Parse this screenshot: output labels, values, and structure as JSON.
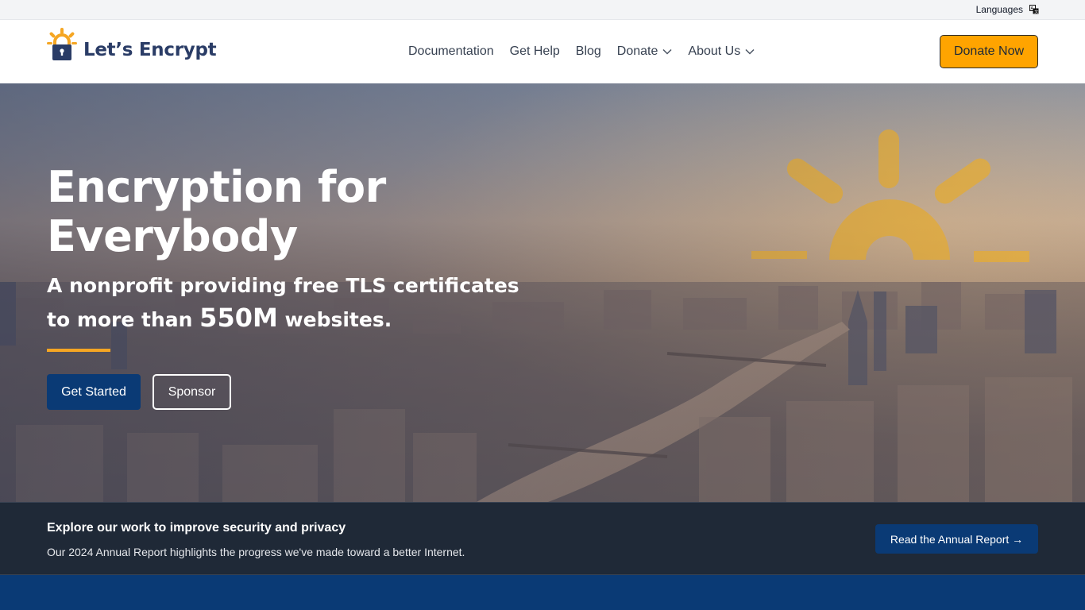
{
  "langbar": {
    "label": "Languages",
    "icon": "translate-icon"
  },
  "header": {
    "logo_text": "Let’s Encrypt",
    "nav": [
      {
        "label": "Documentation",
        "has_dropdown": false
      },
      {
        "label": "Get Help",
        "has_dropdown": false
      },
      {
        "label": "Blog",
        "has_dropdown": false
      },
      {
        "label": "Donate",
        "has_dropdown": true
      },
      {
        "label": "About Us",
        "has_dropdown": true
      }
    ],
    "donate_button": "Donate Now"
  },
  "hero": {
    "title": "Encryption for Everybody",
    "subtitle_part1": "A nonprofit providing free TLS certificates to more than ",
    "subtitle_big": "550M",
    "subtitle_part2": " websites.",
    "primary_button": "Get Started",
    "secondary_button": "Sponsor"
  },
  "report": {
    "title": "Explore our work to improve security and privacy",
    "description": "Our 2024 Annual Report highlights the progress we've made toward a better Internet.",
    "button": "Read the Annual Report →"
  },
  "colors": {
    "brand_navy": "#2a3c66",
    "accent_orange": "#ffa400",
    "primary_blue": "#0a3a75",
    "dark_band": "#1f2937"
  }
}
